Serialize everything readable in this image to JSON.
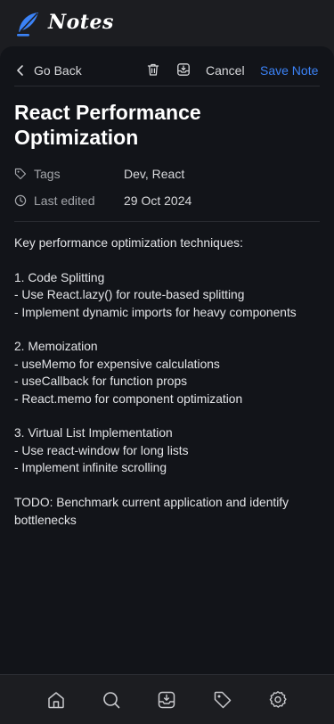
{
  "app": {
    "brand": "Notes",
    "accent_color": "#3b82f6",
    "logo_icon": "feather-icon"
  },
  "toolbar": {
    "back_label": "Go Back",
    "delete_icon": "trash-icon",
    "archive_icon": "archive-download-icon",
    "cancel_label": "Cancel",
    "save_label": "Save Note"
  },
  "note": {
    "title": "React Performance Optimization",
    "tags_label": "Tags",
    "tags_value": "Dev, React",
    "last_edited_label": "Last edited",
    "last_edited_value": "29 Oct 2024",
    "body": "Key performance optimization techniques:\n\n1. Code Splitting\n- Use React.lazy() for route-based splitting\n- Implement dynamic imports for heavy components\n\n2. Memoization\n- useMemo for expensive calculations\n- useCallback for function props\n- React.memo for component optimization\n\n3. Virtual List Implementation\n- Use react-window for long lists\n- Implement infinite scrolling\n\nTODO: Benchmark current application and identify bottlenecks"
  },
  "bottom_nav": {
    "items": [
      {
        "icon": "home-icon"
      },
      {
        "icon": "search-icon"
      },
      {
        "icon": "archive-icon"
      },
      {
        "icon": "tag-icon"
      },
      {
        "icon": "settings-icon"
      }
    ]
  }
}
